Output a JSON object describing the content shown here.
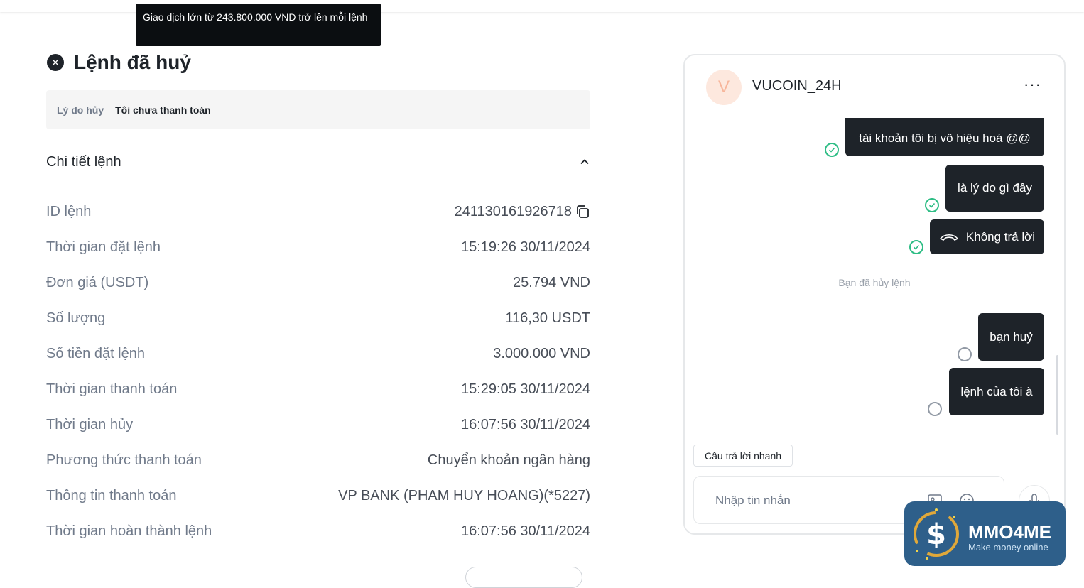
{
  "tooltip": {
    "text": "Giao dịch lớn từ 243.800.000 VND trở lên mỗi lệnh"
  },
  "order": {
    "status_title": "Lệnh đã huỷ",
    "reason_label": "Lý do hủy",
    "reason_value": "Tôi chưa thanh toán",
    "section_title": "Chi tiết lệnh",
    "details": [
      {
        "label": "ID lệnh",
        "value": "241130161926718"
      },
      {
        "label": "Thời gian đặt lệnh",
        "value": "15:19:26 30/11/2024"
      },
      {
        "label": "Đơn giá (USDT)",
        "value": "25.794 VND"
      },
      {
        "label": "Số lượng",
        "value": "116,30 USDT"
      },
      {
        "label": "Số tiền đặt lệnh",
        "value": "3.000.000 VND"
      },
      {
        "label": "Thời gian thanh toán",
        "value": "15:29:05 30/11/2024"
      },
      {
        "label": "Thời gian hủy",
        "value": "16:07:56 30/11/2024"
      },
      {
        "label": "Phương thức thanh toán",
        "value": "Chuyển khoản ngân hàng"
      },
      {
        "label": "Thông tin thanh toán",
        "value": "VP BANK (PHAM HUY HOANG)(*5227)"
      },
      {
        "label": "Thời gian hoàn thành lệnh",
        "value": "16:07:56 30/11/2024"
      }
    ]
  },
  "chat": {
    "avatar_letter": "V",
    "name": "VUCOIN_24H",
    "more": "···",
    "messages": [
      {
        "text": "tài khoản tôi bị vô hiệu hoá @@",
        "status": "read"
      },
      {
        "text": "là lý do gì đây",
        "status": "read"
      },
      {
        "text": "Không trả lời",
        "status": "read",
        "icon": "phone-hangup-icon"
      },
      {
        "text": "bạn huỷ",
        "status": "sent"
      },
      {
        "text": "lệnh của tôi à",
        "status": "sent"
      }
    ],
    "system_note": "Bạn đã hủy lệnh",
    "quick_reply_label": "Câu trả lời nhanh",
    "input_placeholder": "Nhập tin nhắn"
  },
  "watermark": {
    "title": "MMO4ME",
    "subtitle": "Make money online"
  },
  "colors": {
    "bubble": "#1e2329",
    "read_check": "#2ebd85",
    "muted_text": "#707a8a",
    "watermark_bg": "#2e5f8a"
  }
}
